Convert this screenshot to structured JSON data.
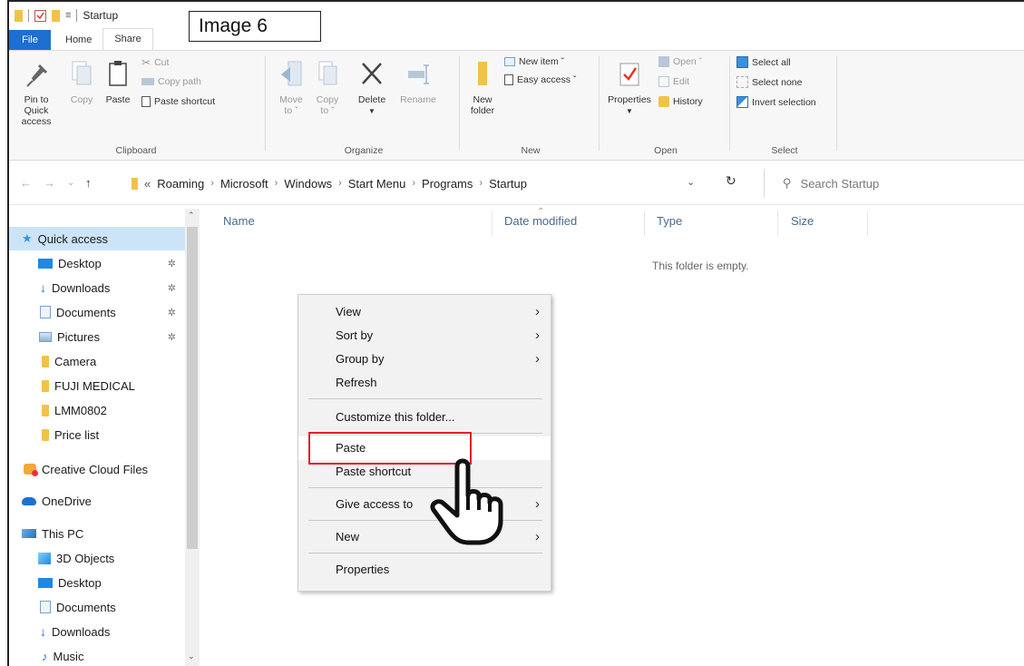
{
  "window": {
    "title": "Startup",
    "caption_label": "Image 6"
  },
  "ribbon_tabs": [
    "File",
    "Home",
    "Share"
  ],
  "ribbon": {
    "clipboard": {
      "label": "Clipboard",
      "pin_label_1": "Pin to Quick",
      "pin_label_2": "access",
      "copy_label": "Copy",
      "paste_label": "Paste",
      "cut_label": "Cut",
      "copy_path_label": "Copy path",
      "paste_shortcut_label": "Paste shortcut"
    },
    "organize": {
      "label": "Organize",
      "move_to_1": "Move",
      "move_to_2": "to ˇ",
      "copy_to_1": "Copy",
      "copy_to_2": "to ˇ",
      "delete_label": "Delete",
      "rename_label": "Rename"
    },
    "new": {
      "label": "New",
      "new_folder_1": "New",
      "new_folder_2": "folder",
      "new_item_label": "New item ˇ",
      "easy_access_label": "Easy access ˇ"
    },
    "open": {
      "label": "Open",
      "properties_label": "Properties",
      "open_label": "Open ˇ",
      "edit_label": "Edit",
      "history_label": "History"
    },
    "select": {
      "label": "Select",
      "select_all_label": "Select all",
      "select_none_label": "Select none",
      "invert_label": "Invert selection"
    }
  },
  "address_bar": {
    "overflow": "«",
    "breadcrumbs": [
      "Roaming",
      "Microsoft",
      "Windows",
      "Start Menu",
      "Programs",
      "Startup"
    ],
    "search_placeholder": "Search Startup"
  },
  "nav_pane": {
    "items": [
      {
        "label": "Quick access",
        "icon": "star-icon"
      },
      {
        "label": "Desktop",
        "icon": "desktop-icon",
        "pinned": true
      },
      {
        "label": "Downloads",
        "icon": "download-icon",
        "pinned": true
      },
      {
        "label": "Documents",
        "icon": "documents-icon",
        "pinned": true
      },
      {
        "label": "Pictures",
        "icon": "pictures-icon",
        "pinned": true
      },
      {
        "label": "Camera",
        "icon": "folder-icon"
      },
      {
        "label": "FUJI MEDICAL",
        "icon": "folder-icon"
      },
      {
        "label": "LMM0802",
        "icon": "folder-icon"
      },
      {
        "label": "Price list",
        "icon": "folder-icon"
      },
      {
        "label": "Creative Cloud Files",
        "icon": "creative-cloud-icon"
      },
      {
        "label": "OneDrive",
        "icon": "cloud-icon"
      },
      {
        "label": "This PC",
        "icon": "pc-icon"
      },
      {
        "label": "3D Objects",
        "icon": "3d-objects-icon"
      },
      {
        "label": "Desktop",
        "icon": "desktop-icon"
      },
      {
        "label": "Documents",
        "icon": "documents-icon"
      },
      {
        "label": "Downloads",
        "icon": "download-icon"
      },
      {
        "label": "Music",
        "icon": "music-icon"
      }
    ]
  },
  "file_list": {
    "columns": [
      "Name",
      "Date modified",
      "Type",
      "Size"
    ],
    "empty_message": "This folder is empty."
  },
  "context_menu": {
    "items": [
      {
        "label": "View",
        "submenu": true
      },
      {
        "label": "Sort by",
        "submenu": true
      },
      {
        "label": "Group by",
        "submenu": true
      },
      {
        "label": "Refresh",
        "submenu": false
      },
      {
        "label": "Customize this folder...",
        "submenu": false
      },
      {
        "label": "Paste",
        "submenu": false,
        "highlighted": true
      },
      {
        "label": "Paste shortcut",
        "submenu": false
      },
      {
        "label": "Give access to",
        "submenu": true
      },
      {
        "label": "New",
        "submenu": true
      },
      {
        "label": "Properties",
        "submenu": false
      }
    ]
  },
  "colors": {
    "file_tab": "#1e6fcf",
    "selection": "#cce4f7",
    "highlight_box": "#e0212b",
    "folder": "#f1c24b"
  }
}
